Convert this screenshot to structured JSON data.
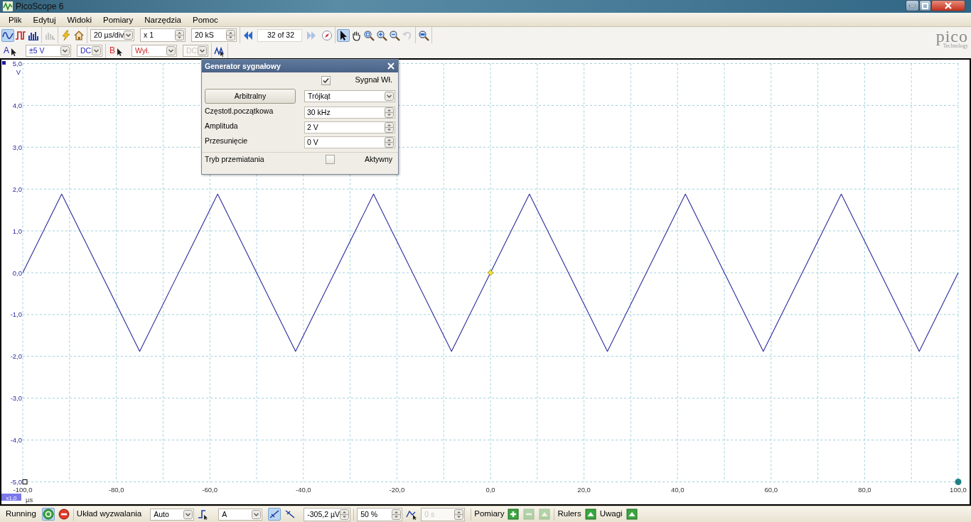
{
  "window": {
    "title": "PicoScope 6"
  },
  "menu": [
    "Plik",
    "Edytuj",
    "Widoki",
    "Pomiary",
    "Narzędzia",
    "Pomoc"
  ],
  "toolbar": {
    "modes": [
      {
        "selected": true
      },
      {
        "selected": false
      },
      {
        "selected": false
      }
    ],
    "persistence": {
      "disabled": true
    },
    "timebase": "20 µs/div",
    "zoom": "x 1",
    "samples": "20 kS",
    "buffer": {
      "position": "32 of 32",
      "next_disabled": true
    },
    "tools": [
      {
        "selected": true
      },
      {
        "selected": false
      },
      {
        "selected": false
      },
      {
        "selected": false
      },
      {
        "selected": false
      }
    ],
    "undo_zoom": {
      "disabled": true
    }
  },
  "channels": [
    {
      "label": "A",
      "range": "±5 V",
      "coupling": "DC",
      "enabled": true,
      "color": "#1e1eb4"
    },
    {
      "label": "B",
      "range": "Wył.",
      "coupling": "DC",
      "enabled": false,
      "color": "#d02828"
    }
  ],
  "logo": {
    "name": "pico",
    "tagline": "Technology"
  },
  "plot": {
    "zoom_badge": "x1,0",
    "chart_data": {
      "type": "line",
      "xlabel": "µs",
      "ylabel": "V",
      "x": [
        -100,
        -91.67,
        -75,
        -58.33,
        -41.67,
        -25,
        -8.33,
        8.33,
        25,
        41.67,
        58.33,
        75,
        91.67,
        100
      ],
      "grid": true,
      "series": [
        {
          "color": "#2b2b9c",
          "values": [
            0,
            1.88,
            -1.88,
            1.88,
            -1.88,
            1.88,
            -1.88,
            1.88,
            -1.88,
            1.88,
            -1.88,
            1.88,
            -1.88,
            0
          ]
        }
      ],
      "xlim": [
        -100,
        100
      ],
      "ylim": [
        -5,
        5
      ],
      "xticks": [
        {
          "value": -100,
          "label": "-100,0"
        },
        {
          "value": -80,
          "label": "-80,0"
        },
        {
          "value": -60,
          "label": "-60,0"
        },
        {
          "value": -40,
          "label": "-40,0"
        },
        {
          "value": -20,
          "label": "-20,0"
        },
        {
          "value": 0,
          "label": "0,0"
        },
        {
          "value": 20,
          "label": "20,0"
        },
        {
          "value": 40,
          "label": "40,0"
        },
        {
          "value": 60,
          "label": "60,0"
        },
        {
          "value": 80,
          "label": "80,0"
        },
        {
          "value": 100,
          "label": "100,0"
        }
      ],
      "yticks": [
        {
          "value": 5,
          "label": "5,0"
        },
        {
          "value": 4,
          "label": "4,0"
        },
        {
          "value": 3,
          "label": "3,0"
        },
        {
          "value": 2,
          "label": "2,0"
        },
        {
          "value": 1,
          "label": "1,0"
        },
        {
          "value": 0,
          "label": "0,0"
        },
        {
          "value": -1,
          "label": "-1,0"
        },
        {
          "value": -2,
          "label": "-2,0"
        },
        {
          "value": -3,
          "label": "-3,0"
        },
        {
          "value": -4,
          "label": "-4,0"
        },
        {
          "value": -5,
          "label": "-5,0"
        }
      ]
    }
  },
  "signal_generator": {
    "title": "Generator sygnałowy",
    "signal_on": {
      "label": "Sygnał Wł.",
      "checked": true
    },
    "arbitrary_button": "Arbitralny",
    "waveform": "Trójkąt",
    "fields": [
      {
        "label": "Częstotl.początkowa",
        "value": "30 kHz"
      },
      {
        "label": "Amplituda",
        "value": "2 V"
      },
      {
        "label": "Przesunięcie",
        "value": "0 V"
      }
    ],
    "sweep": {
      "label": "Tryb przemiatania",
      "checkbox_label": "Aktywny",
      "checked": false
    }
  },
  "status_bar": {
    "run_label": "Running",
    "run_buttons": [
      {
        "selected": true
      },
      {
        "selected": false
      }
    ],
    "trigger_label": "Układ wyzwalania",
    "trigger_mode": "Auto",
    "trigger_source": "A",
    "edges": [
      {
        "selected": true
      },
      {
        "selected": false
      }
    ],
    "threshold": "-305,2 µV",
    "pretrigger": "50 %",
    "delay": {
      "value": "0 s",
      "disabled": true
    },
    "measurements_label": "Pomiary",
    "measurement_buttons": [
      {
        "disabled": false
      },
      {
        "disabled": true
      },
      {
        "disabled": true
      }
    ],
    "rulers_label": "Rulers",
    "notes_label": "Uwagi"
  }
}
